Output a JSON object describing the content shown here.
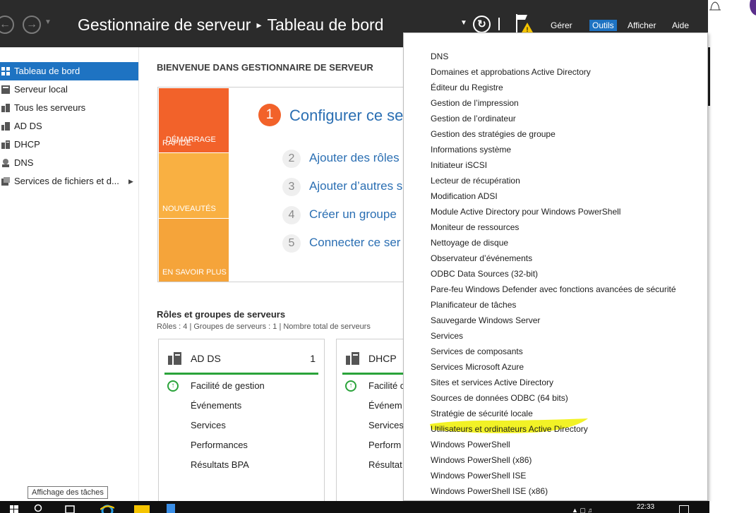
{
  "header": {
    "breadcrumb_root": "Gestionnaire de serveur",
    "breadcrumb_separator": "▸",
    "breadcrumb_page": "Tableau de bord",
    "menu": {
      "gerer": "Gérer",
      "outils": "Outils",
      "afficher": "Afficher",
      "aide": "Aide"
    }
  },
  "sidebar": {
    "items": [
      {
        "label": "Tableau de bord",
        "icon": "dashboard-icon"
      },
      {
        "label": "Serveur local",
        "icon": "server-icon"
      },
      {
        "label": "Tous les serveurs",
        "icon": "servers-icon"
      },
      {
        "label": "AD DS",
        "icon": "adds-icon"
      },
      {
        "label": "DHCP",
        "icon": "dhcp-icon"
      },
      {
        "label": "DNS",
        "icon": "dns-icon"
      },
      {
        "label": "Services de fichiers et d...",
        "icon": "file-services-icon"
      }
    ]
  },
  "welcome": {
    "title": "BIENVENUE DANS GESTIONNAIRE DE SERVEUR",
    "tiles": {
      "quick_start_line1": "DÉMARRAGE",
      "quick_start_line2": "RAPIDE",
      "new": "NOUVEAUTÉS",
      "learn_more": "EN SAVOIR PLUS"
    },
    "steps": [
      {
        "num": "1",
        "label": "Configurer ce se"
      },
      {
        "num": "2",
        "label": "Ajouter des rôles"
      },
      {
        "num": "3",
        "label": "Ajouter d’autres s"
      },
      {
        "num": "4",
        "label": "Créer un groupe"
      },
      {
        "num": "5",
        "label": "Connecter ce ser"
      }
    ]
  },
  "roles": {
    "title": "Rôles et groupes de serveurs",
    "stats": "Rôles : 4   |   Groupes de serveurs : 1   |   Nombre total de serveurs",
    "cards": [
      {
        "title": "AD DS",
        "count": "1",
        "rows": [
          "Facilité de gestion",
          "Événements",
          "Services",
          "Performances",
          "Résultats BPA"
        ]
      },
      {
        "title": "DHCP",
        "count": "",
        "rows": [
          "Facilité c",
          "Événem",
          "Services",
          "Perform",
          "Résultat"
        ]
      }
    ]
  },
  "tools_menu": {
    "items": [
      "DNS",
      "Domaines et approbations Active Directory",
      "Éditeur du Registre",
      "Gestion de l’impression",
      "Gestion de l’ordinateur",
      "Gestion des stratégies de groupe",
      "Informations système",
      "Initiateur iSCSI",
      "Lecteur de récupération",
      "Modification ADSI",
      "Module Active Directory pour Windows PowerShell",
      "Moniteur de ressources",
      "Nettoyage de disque",
      "Observateur d’événements",
      "ODBC Data Sources (32-bit)",
      "Pare-feu Windows Defender avec fonctions avancées de sécurité",
      "Planificateur de tâches",
      "Sauvegarde Windows Server",
      "Services",
      "Services de composants",
      "Services Microsoft Azure",
      "Sites et services Active Directory",
      "Sources de données ODBC (64 bits)",
      "Stratégie de sécurité locale",
      "Utilisateurs et ordinateurs Active Directory",
      "Windows PowerShell",
      "Windows PowerShell (x86)",
      "Windows PowerShell ISE",
      "Windows PowerShell ISE (x86)"
    ],
    "highlighted_index": 24,
    "highlight_color": "#f0f000"
  },
  "tooltip": "Affichage des tâches",
  "taskbar": {
    "clock": "22:33"
  },
  "colors": {
    "titlebar": "#2b2b2b",
    "accent": "#1e73c2",
    "quick_start": "#f2622a",
    "tile_yellow": "#f9b042",
    "status_green": "#2aa33a",
    "link_blue": "#2b6fb3"
  }
}
